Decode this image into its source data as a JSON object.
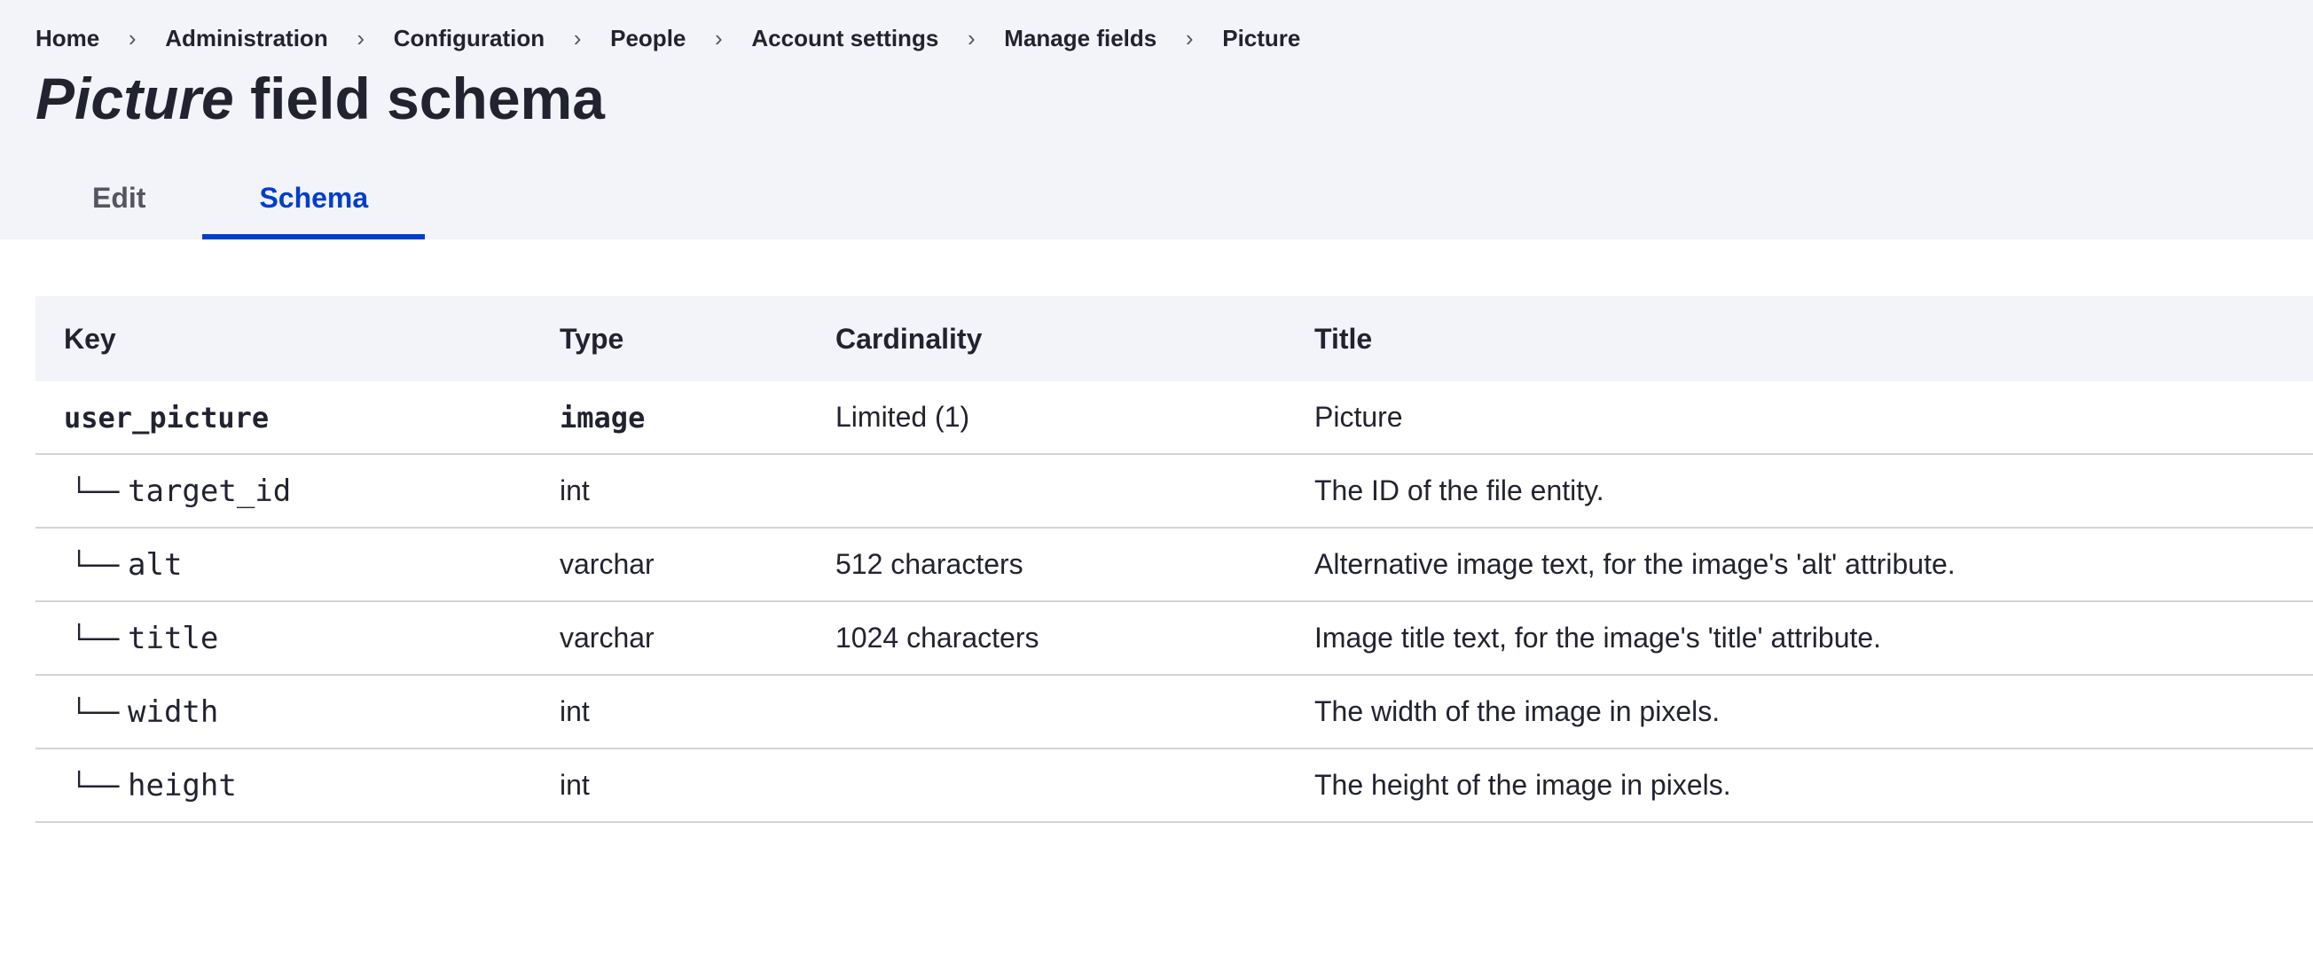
{
  "breadcrumb": [
    {
      "label": "Home"
    },
    {
      "label": "Administration"
    },
    {
      "label": "Configuration"
    },
    {
      "label": "People"
    },
    {
      "label": "Account settings"
    },
    {
      "label": "Manage fields"
    },
    {
      "label": "Picture"
    }
  ],
  "breadcrumb_separator": "›",
  "title": {
    "emphasis": "Picture",
    "rest": " field schema"
  },
  "tabs": [
    {
      "label": "Edit",
      "active": false
    },
    {
      "label": "Schema",
      "active": true
    }
  ],
  "table": {
    "headers": {
      "key": "Key",
      "type": "Type",
      "cardinality": "Cardinality",
      "title": "Title"
    },
    "tree_glyph": "└──",
    "field": {
      "key": "user_picture",
      "type": "image",
      "cardinality": "Limited (1)",
      "title": "Picture"
    },
    "properties": [
      {
        "key": "target_id",
        "type": "int",
        "cardinality": "",
        "title": "The ID of the file entity."
      },
      {
        "key": "alt",
        "type": "varchar",
        "cardinality": "512 characters",
        "title": "Alternative image text, for the image's 'alt' attribute."
      },
      {
        "key": "title",
        "type": "varchar",
        "cardinality": "1024 characters",
        "title": "Image title text, for the image's 'title' attribute."
      },
      {
        "key": "width",
        "type": "int",
        "cardinality": "",
        "title": "The width of the image in pixels."
      },
      {
        "key": "height",
        "type": "int",
        "cardinality": "",
        "title": "The height of the image in pixels."
      }
    ]
  },
  "colors": {
    "accent": "#003ecc",
    "header_bg": "#f3f4f9",
    "text": "#222330",
    "border": "#d3d4d9"
  }
}
